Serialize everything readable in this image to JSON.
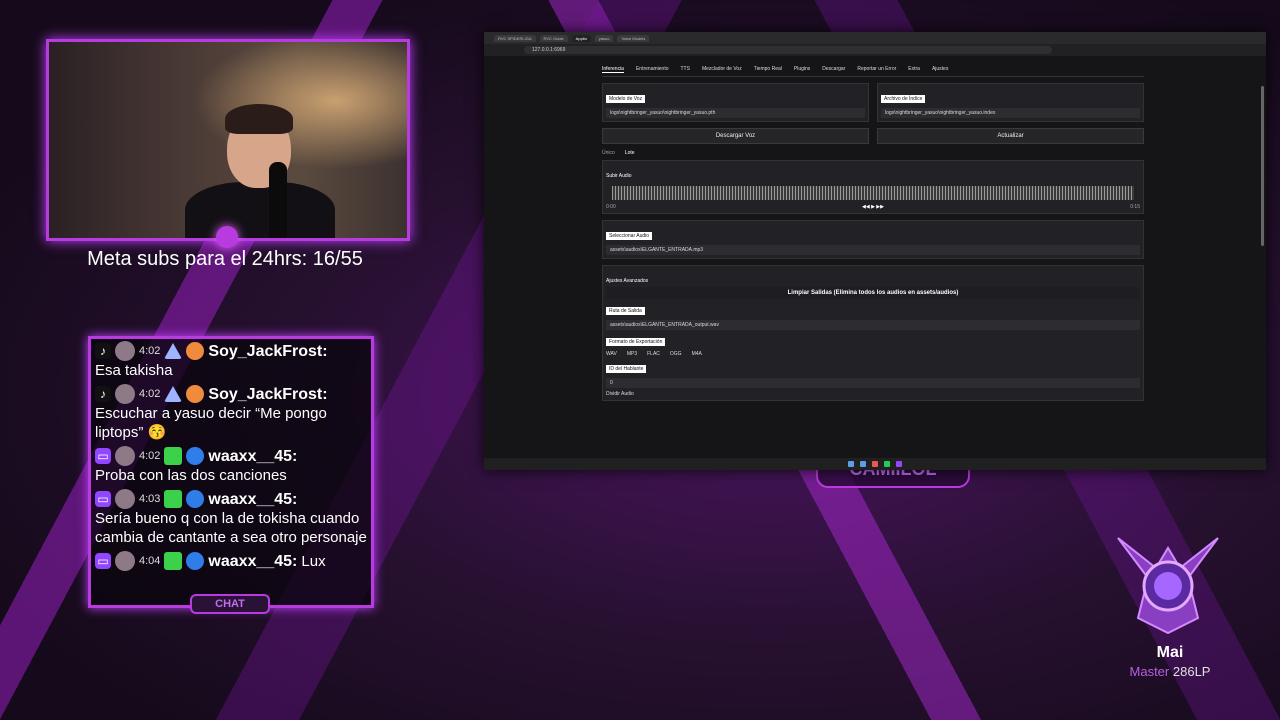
{
  "overlay": {
    "subs_goal": "Meta subs para el 24hrs: 16/55",
    "chat_label": "CHAT",
    "streamer_name": "CAMIILOL",
    "rank": {
      "name": "Mai",
      "tier": "Master",
      "lp": "286LP"
    }
  },
  "chat": [
    {
      "platform": "tiktok",
      "time": "4:02",
      "user": "Soy_JackFrost:",
      "text": "Esa takisha"
    },
    {
      "platform": "tiktok",
      "time": "4:02",
      "user": "Soy_JackFrost:",
      "text": "Escuchar a yasuo decir “Me pongo liptops” 😚"
    },
    {
      "platform": "twitch",
      "time": "4:02",
      "user": "waaxx__45:",
      "text": "Proba con las dos canciones"
    },
    {
      "platform": "twitch",
      "time": "4:03",
      "user": "waaxx__45:",
      "text": "Sería bueno q con la de tokisha cuando cambia de cantante a sea otro personaje"
    },
    {
      "platform": "twitch",
      "time": "4:04",
      "user": "waaxx__45:",
      "text": "Lux"
    }
  ],
  "browser": {
    "tabs": [
      "RVC SPIDERLIGA",
      "RVC Guide",
      "Applio",
      "yasuo",
      "Voice Models"
    ],
    "url": "127.0.0.1:6969",
    "app": {
      "nav": [
        "Inferencia",
        "Entrenamiento",
        "TTS",
        "Mezclador de Voz",
        "Tiempo Real",
        "Plugins",
        "Descargar",
        "Reportar un Error",
        "Extra",
        "Ajustes"
      ],
      "voice_model_label": "Modelo de Voz",
      "voice_model_value": "logs\\nightbringer_yasuo\\nightbringer_yasuo.pth",
      "index_label": "Archivo de Índice",
      "index_value": "logs\\nightbringer_yasuo\\nightbringer_yasuo.index",
      "unload_button": "Descargar Voz",
      "refresh_button": "Actualizar",
      "subtabs": [
        "Único",
        "Lote"
      ],
      "upload_audio": "Subir Audio",
      "time_start": "0:00",
      "time_end": "0:15",
      "select_audio_label": "Seleccionar Audio",
      "select_audio_value": "assets\\audios\\ELGANTE_ENTRADA.mp3",
      "advanced": "Ajustes Avanzados",
      "clear_outputs": "Limpiar Salidas (Elimina todos los audios en assets/audios)",
      "output_path_label": "Ruta de Salida",
      "output_path_value": "assets\\audios\\ELGANTE_ENTRADA_output.wav",
      "export_format_label": "Formato de Exportación",
      "formats": [
        "WAV",
        "MP3",
        "FLAC",
        "OGG",
        "M4A"
      ],
      "speaker_id_label": "ID del Hablante",
      "speaker_id_value": "0",
      "split_audio": "Dividir Audio"
    }
  }
}
